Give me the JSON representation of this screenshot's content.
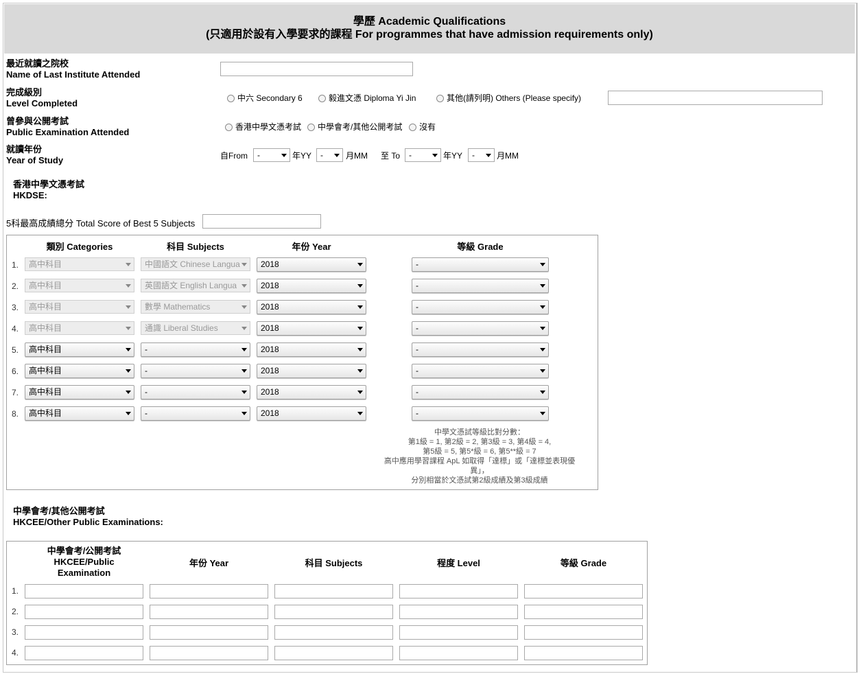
{
  "header": {
    "title_line1": "學歷 Academic Qualifications",
    "title_line2": "(只適用於設有入學要求的課程 For programmes that have admission requirements only)"
  },
  "fields": {
    "institute": {
      "label_zh": "最近就讀之院校",
      "label_en": "Name of Last Institute Attended",
      "value": ""
    },
    "level": {
      "label_zh": "完成級別",
      "label_en": "Level Completed",
      "options": [
        "中六 Secondary 6",
        "毅進文憑 Diploma Yi Jin",
        "其他(請列明) Others (Please specify)"
      ],
      "other_value": ""
    },
    "exam": {
      "label_zh": "曾參與公開考試",
      "label_en": "Public Examination Attended",
      "options": [
        "香港中學文憑考試",
        "中學會考/其他公開考試",
        "沒有"
      ]
    },
    "study_year": {
      "label_zh": "就讀年份",
      "label_en": "Year of Study",
      "from_label": "自From",
      "yy_label": "年YY",
      "mm_label": "月MM",
      "to_label": "至 To",
      "from_year": "-",
      "from_month": "-",
      "to_year": "-",
      "to_month": "-"
    }
  },
  "hkdse": {
    "title_zh": "香港中學文憑考試",
    "title_en": "HKDSE:",
    "total_label": "5科最高成績總分 Total Score of Best 5 Subjects",
    "total_value": "",
    "headers": {
      "categories": "類別 Categories",
      "subjects": "科目 Subjects",
      "year": "年份 Year",
      "grade": "等級 Grade"
    },
    "rows": [
      {
        "num": "1.",
        "category": "高中科目",
        "subject": "中國語文 Chinese Langua",
        "year": "2018",
        "grade": "-"
      },
      {
        "num": "2.",
        "category": "高中科目",
        "subject": "英國語文 English Langua",
        "year": "2018",
        "grade": "-"
      },
      {
        "num": "3.",
        "category": "高中科目",
        "subject": "數學 Mathematics",
        "year": "2018",
        "grade": "-"
      },
      {
        "num": "4.",
        "category": "高中科目",
        "subject": "通識 Liberal Studies",
        "year": "2018",
        "grade": "-"
      },
      {
        "num": "5.",
        "category": "高中科目",
        "subject": "-",
        "year": "2018",
        "grade": "-"
      },
      {
        "num": "6.",
        "category": "高中科目",
        "subject": "-",
        "year": "2018",
        "grade": "-"
      },
      {
        "num": "7.",
        "category": "高中科目",
        "subject": "-",
        "year": "2018",
        "grade": "-"
      },
      {
        "num": "8.",
        "category": "高中科目",
        "subject": "-",
        "year": "2018",
        "grade": "-"
      }
    ],
    "note_lines": [
      "中學文憑試等級比對分數：",
      "第1級 = 1, 第2級 = 2, 第3級 = 3, 第4級 = 4,",
      "第5級 = 5, 第5*級 = 6, 第5**級 = 7",
      "高中應用學習課程 ApL 如取得「達標」或「達標並表現優",
      "異」，",
      "分別相當於文憑試第2級成績及第3級成績"
    ]
  },
  "hkcee": {
    "title_zh": "中學會考/其他公開考試",
    "title_en": "HKCEE/Other Public Examinations:",
    "headers": {
      "exam_l1": "中學會考/公開考試",
      "exam_l2": "HKCEE/Public",
      "exam_l3": "Examination",
      "year": "年份 Year",
      "subjects": "科目 Subjects",
      "level": "程度 Level",
      "grade": "等級 Grade"
    },
    "rows": [
      {
        "num": "1."
      },
      {
        "num": "2."
      },
      {
        "num": "3."
      },
      {
        "num": "4."
      }
    ]
  }
}
